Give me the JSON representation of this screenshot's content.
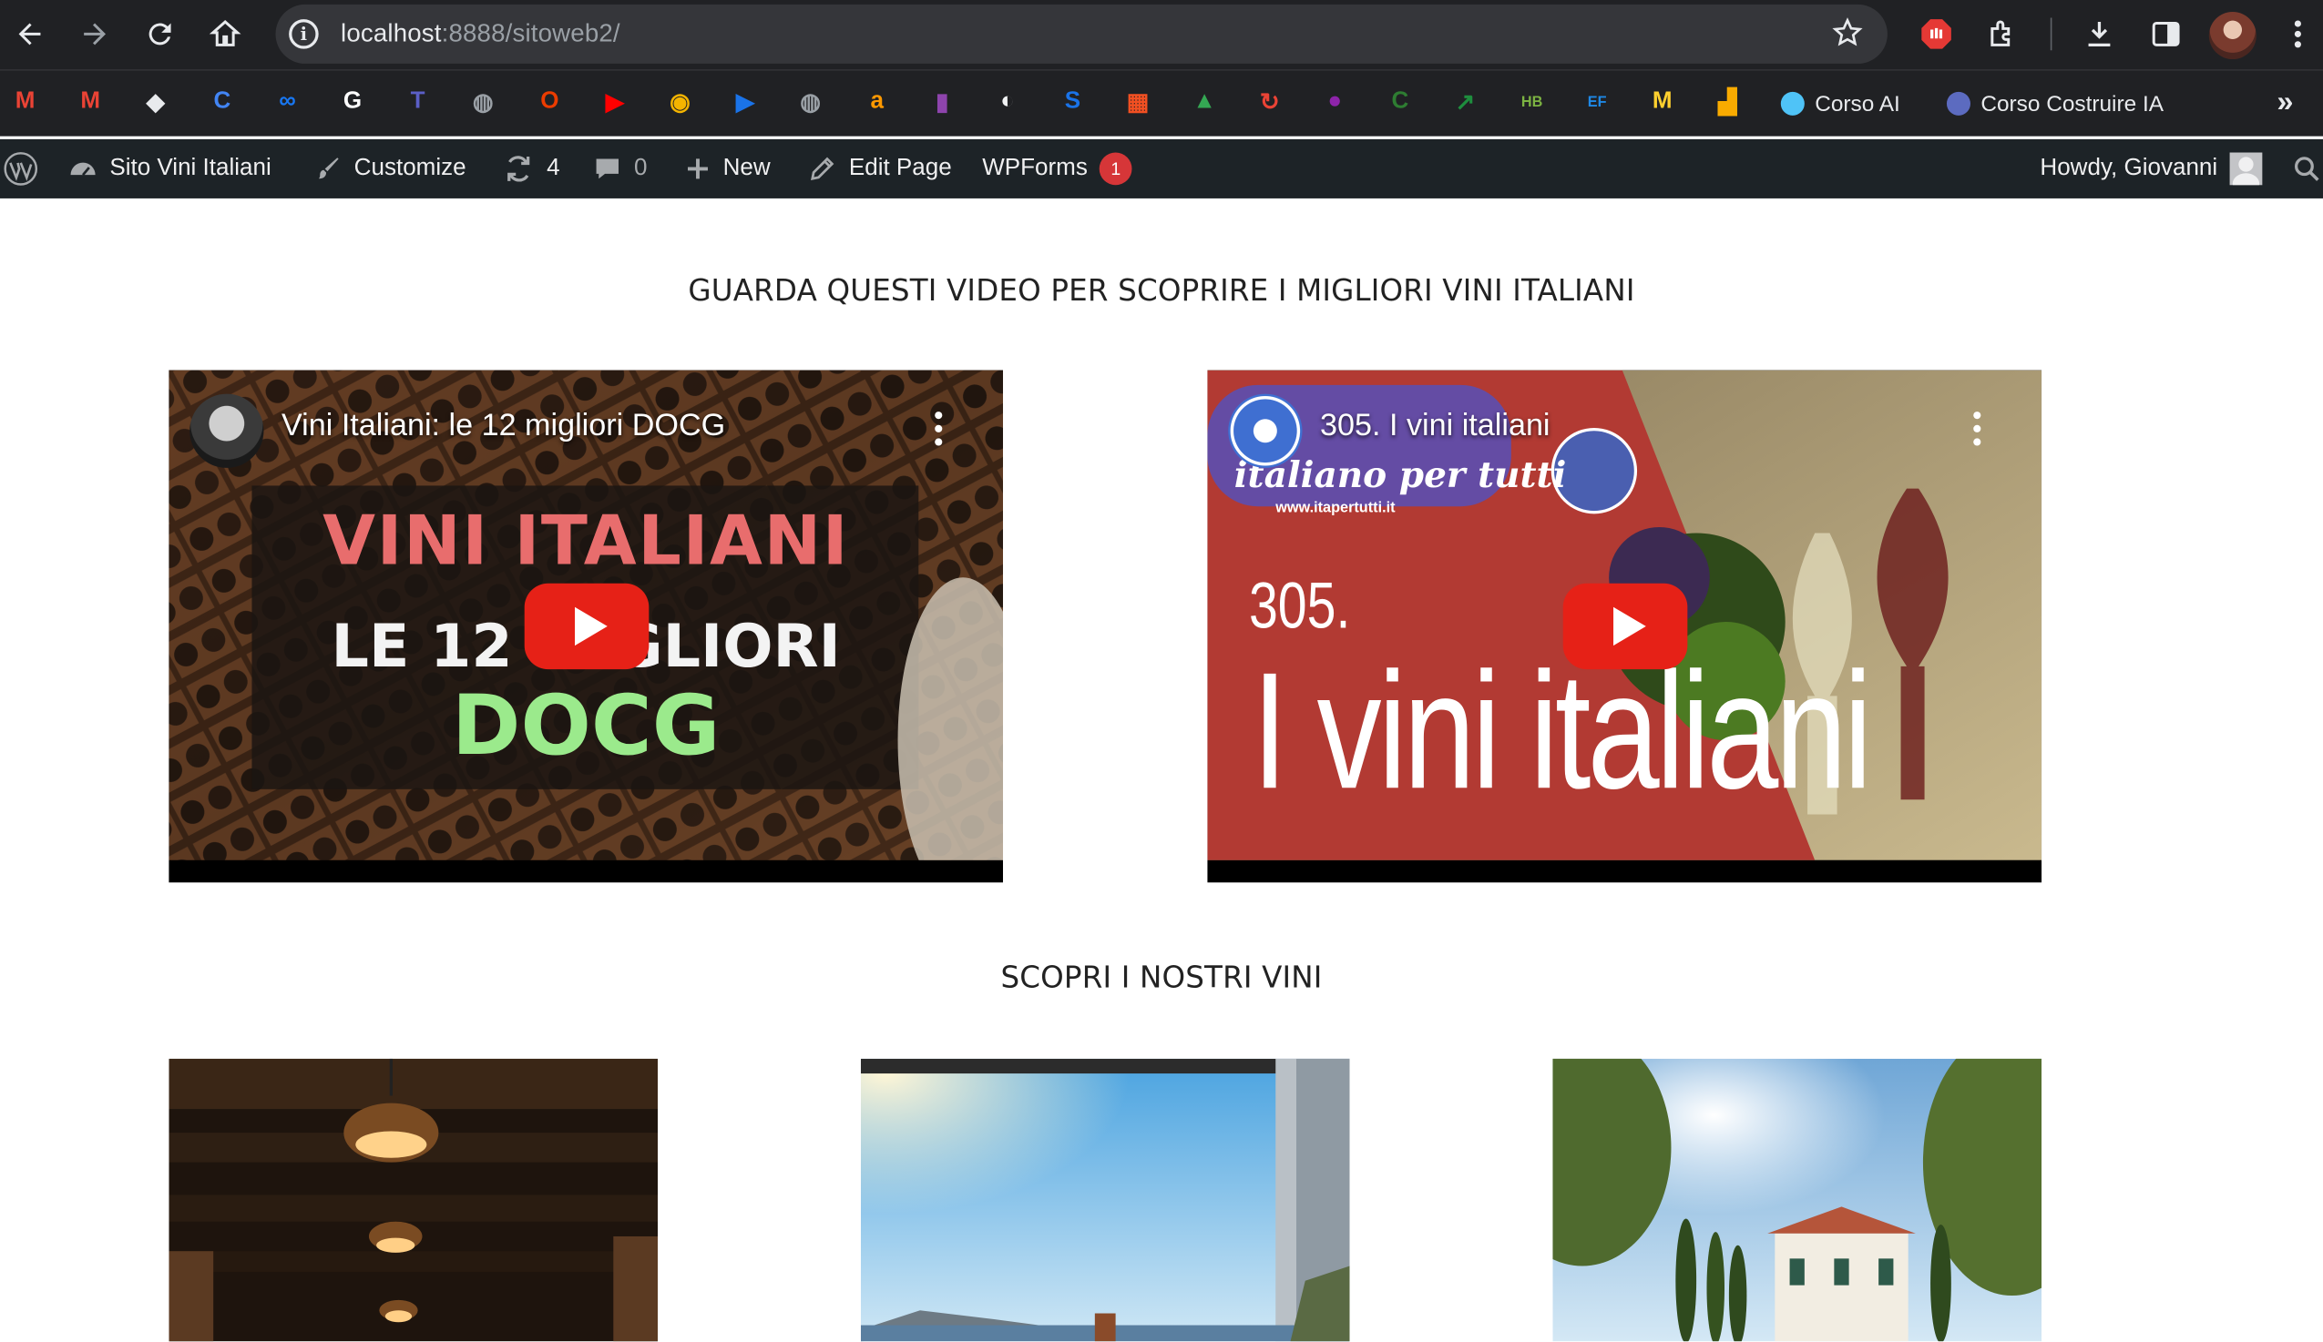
{
  "browser": {
    "url_host": "localhost",
    "url_path": ":8888/sitoweb2/"
  },
  "bookmarks": {
    "items": [
      {
        "icon": "gmail-icon",
        "color": "#ea4335",
        "glyph": "M"
      },
      {
        "icon": "gmail-icon",
        "color": "#ea4335",
        "glyph": "M"
      },
      {
        "icon": "dropbox-icon",
        "color": "#e8eaed",
        "glyph": "◆"
      },
      {
        "icon": "c-circle-icon",
        "color": "#4285f4",
        "glyph": "C"
      },
      {
        "icon": "meta-icon",
        "color": "#1877f2",
        "glyph": "∞"
      },
      {
        "icon": "google-icon",
        "color": "#ffffff",
        "glyph": "G"
      },
      {
        "icon": "teams-icon",
        "color": "#5b5fc7",
        "glyph": "T"
      },
      {
        "icon": "globe-icon",
        "color": "#9aa0a6",
        "glyph": "◍"
      },
      {
        "icon": "office-icon",
        "color": "#eb3c00",
        "glyph": "O"
      },
      {
        "icon": "youtube-icon",
        "color": "#ff0000",
        "glyph": "▶"
      },
      {
        "icon": "disc-icon",
        "color": "#f4b400",
        "glyph": "◉"
      },
      {
        "icon": "play-circle-icon",
        "color": "#1a73e8",
        "glyph": "▶"
      },
      {
        "icon": "globe-icon",
        "color": "#9aa0a6",
        "glyph": "◍"
      },
      {
        "icon": "amazon-icon",
        "color": "#ff9900",
        "glyph": "a"
      },
      {
        "icon": "chart-column-icon",
        "color": "#8e44ad",
        "glyph": "▮"
      },
      {
        "icon": "moon-icon",
        "color": "#f1f3f4",
        "glyph": "◐"
      },
      {
        "icon": "document-icon",
        "color": "#1a73e8",
        "glyph": "S"
      },
      {
        "icon": "microsoft-icon",
        "color": "#f25022",
        "glyph": "▦"
      },
      {
        "icon": "drive-icon",
        "color": "#34a853",
        "glyph": "▲"
      },
      {
        "icon": "refresh-red-icon",
        "color": "#ea4335",
        "glyph": "↻"
      },
      {
        "icon": "dots-icon",
        "color": "#8e24aa",
        "glyph": "●"
      },
      {
        "icon": "c-green-icon",
        "color": "#2e7d32",
        "glyph": "C"
      },
      {
        "icon": "trend-icon",
        "color": "#1e8e3e",
        "glyph": "↗"
      },
      {
        "icon": "hb-icon",
        "color": "#7cb342",
        "glyph": "HB"
      },
      {
        "icon": "ef-icon",
        "color": "#1e88e5",
        "glyph": "EF"
      },
      {
        "icon": "miro-icon",
        "color": "#ffd02f",
        "glyph": "M"
      },
      {
        "icon": "analytics-icon",
        "color": "#f9ab00",
        "glyph": "▟"
      }
    ],
    "folders": [
      {
        "label": "Corso AI",
        "color": "#4fc3f7"
      },
      {
        "label": "Corso Costruire IA",
        "color": "#5c6bc0"
      }
    ]
  },
  "adminbar": {
    "site_name": "Sito Vini Italiani",
    "customize": "Customize",
    "updates_count": "4",
    "comments_count": "0",
    "new_label": "New",
    "edit_page": "Edit Page",
    "wpforms": "WPForms",
    "wpforms_badge": "1",
    "howdy": "Howdy, Giovanni"
  },
  "page": {
    "videos_heading": "GUARDA QUESTI VIDEO PER SCOPRIRE I MIGLIORI VINI ITALIANI",
    "wines_heading": "SCOPRI I NOSTRI VINI",
    "video1": {
      "title": "Vini Italiani: le 12 migliori DOCG",
      "thumb_line1": "VINI ITALIANI",
      "thumb_line2": "LE 12 MIGLIORI",
      "thumb_line3": "DOCG"
    },
    "video2": {
      "title": "305. I vini italiani",
      "thumb_logo": "italiano per tutti",
      "thumb_site": "www.itapertutti.it",
      "thumb_number": "305.",
      "thumb_big": "I vini italiani"
    }
  }
}
